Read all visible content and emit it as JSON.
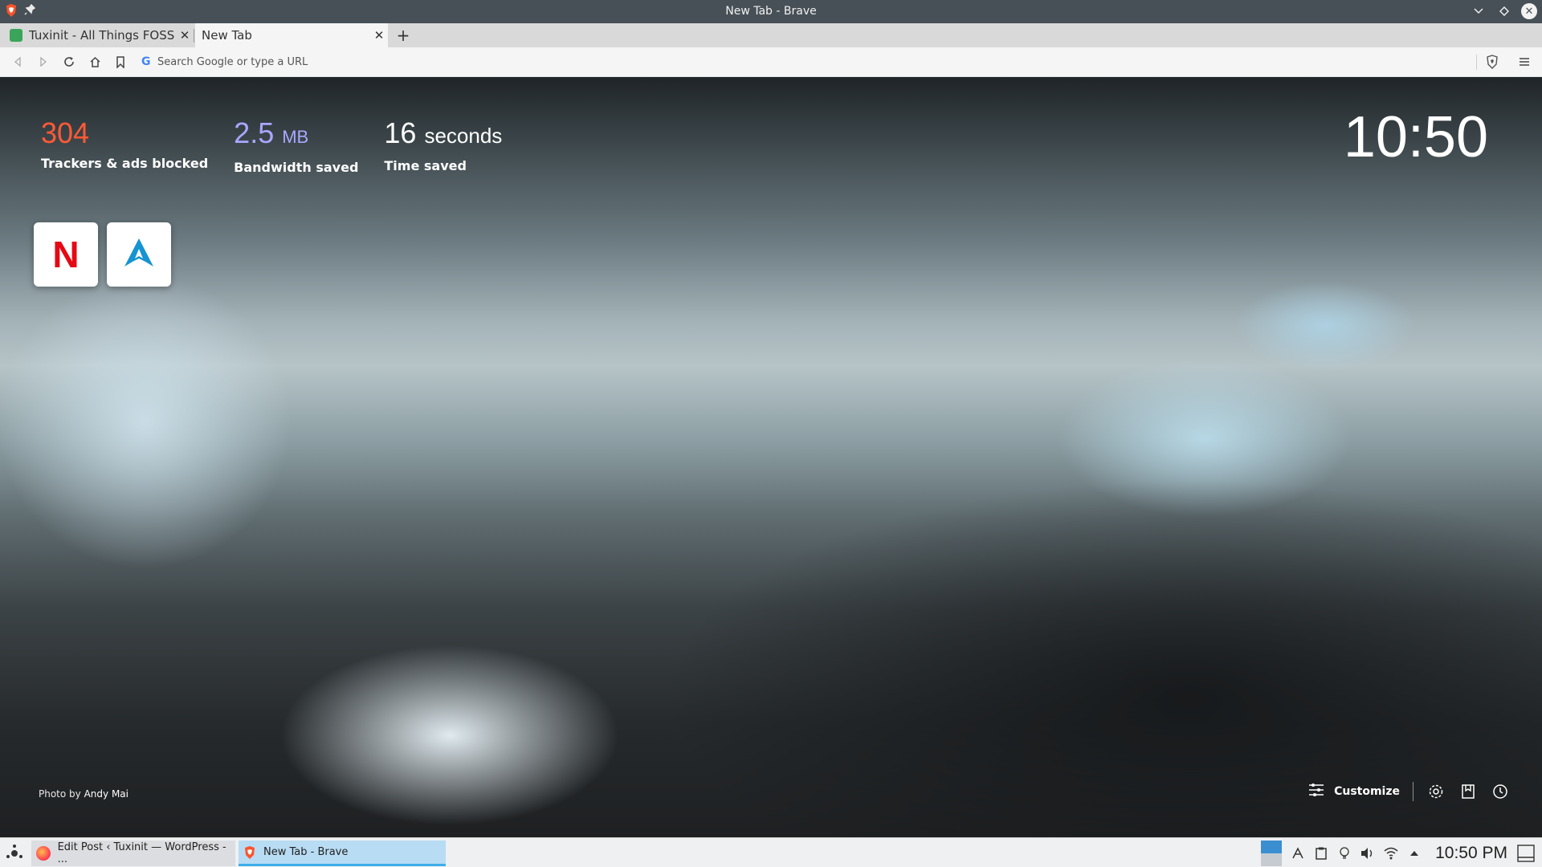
{
  "window": {
    "title": "New Tab - Brave"
  },
  "tabs": [
    {
      "label": "Tuxinit - All Things FOSS & Linux",
      "active": false
    },
    {
      "label": "New Tab",
      "active": true
    }
  ],
  "toolbar": {
    "search_placeholder": "Search Google or type a URL"
  },
  "stats": {
    "trackers_value": "304",
    "trackers_label": "Trackers & ads blocked",
    "bandwidth_value": "2.5",
    "bandwidth_unit": "MB",
    "bandwidth_label": "Bandwidth saved",
    "time_value": "16",
    "time_unit": "seconds",
    "time_label": "Time saved"
  },
  "clock": "10:50",
  "top_sites": [
    {
      "name": "netflix-site",
      "letter": "N",
      "color": "#e50914"
    },
    {
      "name": "arch-site",
      "letter": "A",
      "color": "#1793d1"
    }
  ],
  "photo_credit": {
    "prefix": "Photo by",
    "author": "Andy Mai"
  },
  "customize_label": "Customize",
  "taskbar": {
    "tasks": [
      {
        "label": "Edit Post ‹ Tuxinit — WordPress - ...",
        "active": false
      },
      {
        "label": "New Tab - Brave",
        "active": true
      }
    ],
    "clock": "10:50 PM"
  },
  "colors": {
    "trackers": "#ff5a36",
    "bandwidth": "#a9a7ff",
    "brave": "#fb542b",
    "task_active": "#b8dcf3"
  }
}
